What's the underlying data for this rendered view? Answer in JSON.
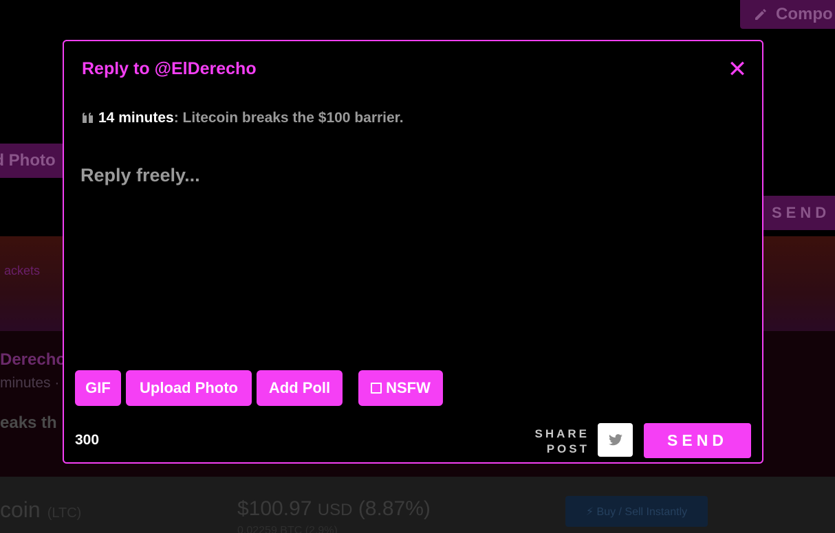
{
  "background": {
    "compose_label": "Compo",
    "upload_photo_label": "ad Photo",
    "send_label": "SEND",
    "banner_text": "ackets",
    "post_author": "Derecho",
    "post_meta": "minutes ·",
    "post_text": "eaks th",
    "ticker_name": "coin",
    "ticker_symbol": "(LTC)",
    "ticker_price": "$100.97",
    "ticker_currency": "USD",
    "ticker_change": "(8.87%)",
    "ticker_btc": "0.02259 BTC (2.9%)",
    "buy_button_label": "⚡ Buy / Sell Instantly"
  },
  "modal": {
    "title": "Reply to @ElDerecho",
    "close_symbol": "✕",
    "quote": {
      "time": "14 minutes",
      "separator": ": ",
      "text": "Litecoin breaks the $100 barrier."
    },
    "reply_placeholder": "Reply freely...",
    "toolbar": {
      "gif_label": "GIF",
      "upload_photo_label": "Upload Photo",
      "add_poll_label": "Add Poll",
      "nsfw_label": "NSFW"
    },
    "char_count": "300",
    "share": {
      "line1": "SHARE",
      "line2": "POST"
    },
    "send_label": "SEND"
  },
  "colors": {
    "accent": "#f53ff5",
    "background": "#000000",
    "muted_text": "#9a9a9a"
  },
  "icons": {
    "quote": "quote-icon",
    "close": "close-icon",
    "twitter": "twitter-icon",
    "pencil": "pencil-icon",
    "checkbox": "checkbox-icon"
  }
}
